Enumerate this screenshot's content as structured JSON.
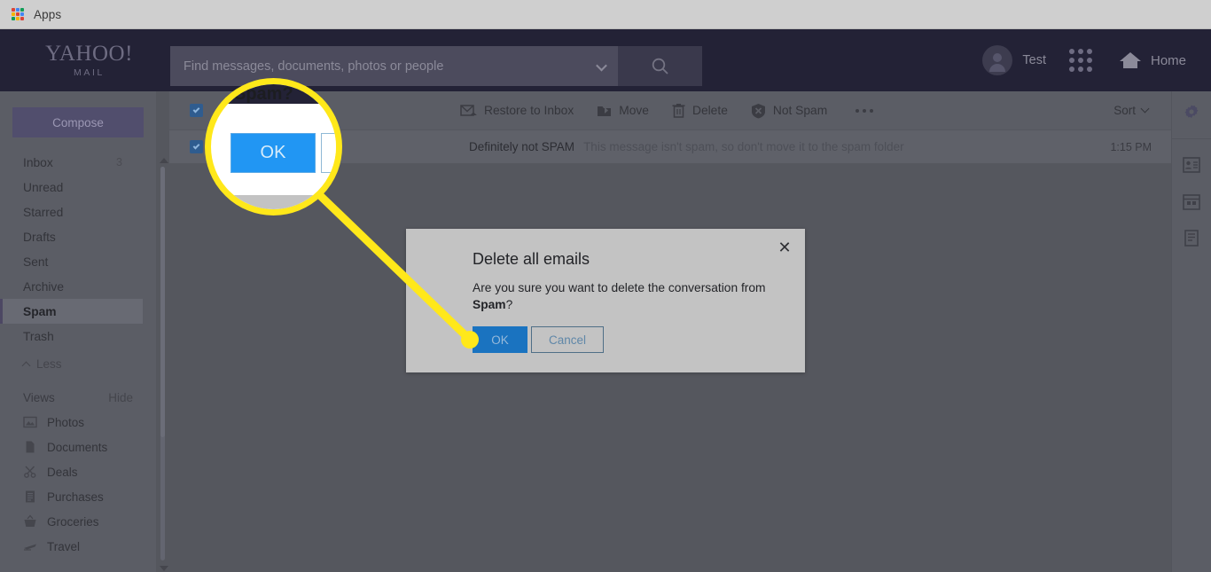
{
  "browser": {
    "apps_label": "Apps",
    "apps_icon": "apps-grid-icon"
  },
  "header": {
    "logo_main": "YAHOO!",
    "logo_sub": "MAIL",
    "search": {
      "placeholder": "Find messages, documents, photos or people",
      "value": "",
      "dropdown_icon": "chevron-down-icon",
      "search_icon": "search-icon"
    },
    "account_name": "Test",
    "avatar_icon": "avatar-icon",
    "apps_launcher_icon": "grid-dots-icon",
    "home_label": "Home",
    "home_icon": "house-icon"
  },
  "sidebar": {
    "compose_label": "Compose",
    "folders": [
      {
        "label": "Inbox",
        "badge": "3",
        "active": false
      },
      {
        "label": "Unread",
        "badge": "",
        "active": false
      },
      {
        "label": "Starred",
        "badge": "",
        "active": false
      },
      {
        "label": "Drafts",
        "badge": "",
        "active": false
      },
      {
        "label": "Sent",
        "badge": "",
        "active": false
      },
      {
        "label": "Archive",
        "badge": "",
        "active": false
      },
      {
        "label": "Spam",
        "badge": "",
        "active": true
      },
      {
        "label": "Trash",
        "badge": "",
        "active": false
      }
    ],
    "less_label": "Less",
    "less_icon": "chevron-up-icon",
    "views_title": "Views",
    "views_hide_label": "Hide",
    "views": [
      {
        "label": "Photos",
        "icon": "photo-icon"
      },
      {
        "label": "Documents",
        "icon": "document-icon"
      },
      {
        "label": "Deals",
        "icon": "scissors-icon"
      },
      {
        "label": "Purchases",
        "icon": "receipt-icon"
      },
      {
        "label": "Groceries",
        "icon": "basket-icon"
      },
      {
        "label": "Travel",
        "icon": "airplane-icon"
      }
    ],
    "scroll_up_icon": "scroll-up-arrow",
    "scroll_down_icon": "scroll-down-arrow"
  },
  "toolbar": {
    "select_all_checkbox": "checked",
    "actions": [
      {
        "label": "Restore to Inbox",
        "icon": "restore-to-inbox-icon"
      },
      {
        "label": "Move",
        "icon": "move-folder-icon"
      },
      {
        "label": "Delete",
        "icon": "trash-icon"
      },
      {
        "label": "Not Spam",
        "icon": "shield-icon"
      }
    ],
    "more_icon": "more-horizontal-icon",
    "sort_label": "Sort",
    "sort_icon": "chevron-down-icon"
  },
  "message_list": [
    {
      "checkbox": "checked",
      "subject": "Definitely not SPAM",
      "snippet": "This message isn't spam, so don't move it to the spam folder",
      "time": "1:15 PM"
    }
  ],
  "right_rail": [
    {
      "icon": "gear-icon",
      "name": "settings"
    },
    {
      "icon": "contacts-icon",
      "name": "contacts"
    },
    {
      "icon": "calendar-icon",
      "name": "calendar"
    },
    {
      "icon": "notepad-icon",
      "name": "notepad"
    }
  ],
  "modal": {
    "title": "Delete all emails",
    "warning_icon": "warning-triangle-icon",
    "close_icon": "close-icon",
    "body_lead": "Are you sure you want to delete the conversation from",
    "body_bold": "Spam",
    "body_tail": "?",
    "ok_label": "OK",
    "cancel_label": "Cancel"
  },
  "callout": {
    "magnified_heading": "Spam?",
    "magnified_ok_label": "OK",
    "highlight_color": "#ffe81a"
  },
  "colors": {
    "header_bg": "#232236",
    "overlay": "#55575e",
    "sidebar_bg": "#5b5d65",
    "accent_blue": "#1a73c0",
    "warning_red": "#cc1346",
    "compose_purple": "#514e6d"
  }
}
